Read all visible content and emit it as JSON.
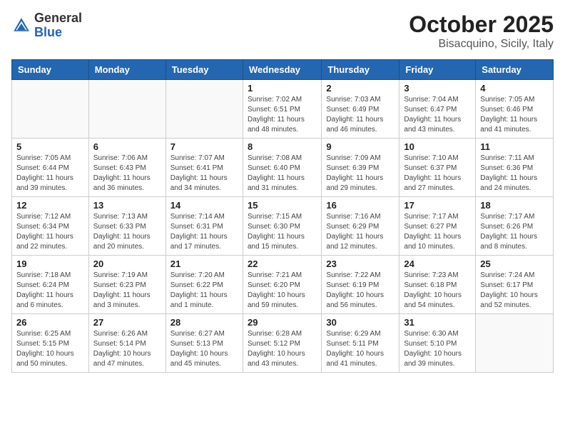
{
  "header": {
    "logo_general": "General",
    "logo_blue": "Blue",
    "month_title": "October 2025",
    "location": "Bisacquino, Sicily, Italy"
  },
  "days_of_week": [
    "Sunday",
    "Monday",
    "Tuesday",
    "Wednesday",
    "Thursday",
    "Friday",
    "Saturday"
  ],
  "weeks": [
    [
      {
        "day": "",
        "info": ""
      },
      {
        "day": "",
        "info": ""
      },
      {
        "day": "",
        "info": ""
      },
      {
        "day": "1",
        "info": "Sunrise: 7:02 AM\nSunset: 6:51 PM\nDaylight: 11 hours and 48 minutes."
      },
      {
        "day": "2",
        "info": "Sunrise: 7:03 AM\nSunset: 6:49 PM\nDaylight: 11 hours and 46 minutes."
      },
      {
        "day": "3",
        "info": "Sunrise: 7:04 AM\nSunset: 6:47 PM\nDaylight: 11 hours and 43 minutes."
      },
      {
        "day": "4",
        "info": "Sunrise: 7:05 AM\nSunset: 6:46 PM\nDaylight: 11 hours and 41 minutes."
      }
    ],
    [
      {
        "day": "5",
        "info": "Sunrise: 7:05 AM\nSunset: 6:44 PM\nDaylight: 11 hours and 39 minutes."
      },
      {
        "day": "6",
        "info": "Sunrise: 7:06 AM\nSunset: 6:43 PM\nDaylight: 11 hours and 36 minutes."
      },
      {
        "day": "7",
        "info": "Sunrise: 7:07 AM\nSunset: 6:41 PM\nDaylight: 11 hours and 34 minutes."
      },
      {
        "day": "8",
        "info": "Sunrise: 7:08 AM\nSunset: 6:40 PM\nDaylight: 11 hours and 31 minutes."
      },
      {
        "day": "9",
        "info": "Sunrise: 7:09 AM\nSunset: 6:39 PM\nDaylight: 11 hours and 29 minutes."
      },
      {
        "day": "10",
        "info": "Sunrise: 7:10 AM\nSunset: 6:37 PM\nDaylight: 11 hours and 27 minutes."
      },
      {
        "day": "11",
        "info": "Sunrise: 7:11 AM\nSunset: 6:36 PM\nDaylight: 11 hours and 24 minutes."
      }
    ],
    [
      {
        "day": "12",
        "info": "Sunrise: 7:12 AM\nSunset: 6:34 PM\nDaylight: 11 hours and 22 minutes."
      },
      {
        "day": "13",
        "info": "Sunrise: 7:13 AM\nSunset: 6:33 PM\nDaylight: 11 hours and 20 minutes."
      },
      {
        "day": "14",
        "info": "Sunrise: 7:14 AM\nSunset: 6:31 PM\nDaylight: 11 hours and 17 minutes."
      },
      {
        "day": "15",
        "info": "Sunrise: 7:15 AM\nSunset: 6:30 PM\nDaylight: 11 hours and 15 minutes."
      },
      {
        "day": "16",
        "info": "Sunrise: 7:16 AM\nSunset: 6:29 PM\nDaylight: 11 hours and 12 minutes."
      },
      {
        "day": "17",
        "info": "Sunrise: 7:17 AM\nSunset: 6:27 PM\nDaylight: 11 hours and 10 minutes."
      },
      {
        "day": "18",
        "info": "Sunrise: 7:17 AM\nSunset: 6:26 PM\nDaylight: 11 hours and 8 minutes."
      }
    ],
    [
      {
        "day": "19",
        "info": "Sunrise: 7:18 AM\nSunset: 6:24 PM\nDaylight: 11 hours and 6 minutes."
      },
      {
        "day": "20",
        "info": "Sunrise: 7:19 AM\nSunset: 6:23 PM\nDaylight: 11 hours and 3 minutes."
      },
      {
        "day": "21",
        "info": "Sunrise: 7:20 AM\nSunset: 6:22 PM\nDaylight: 11 hours and 1 minute."
      },
      {
        "day": "22",
        "info": "Sunrise: 7:21 AM\nSunset: 6:20 PM\nDaylight: 10 hours and 59 minutes."
      },
      {
        "day": "23",
        "info": "Sunrise: 7:22 AM\nSunset: 6:19 PM\nDaylight: 10 hours and 56 minutes."
      },
      {
        "day": "24",
        "info": "Sunrise: 7:23 AM\nSunset: 6:18 PM\nDaylight: 10 hours and 54 minutes."
      },
      {
        "day": "25",
        "info": "Sunrise: 7:24 AM\nSunset: 6:17 PM\nDaylight: 10 hours and 52 minutes."
      }
    ],
    [
      {
        "day": "26",
        "info": "Sunrise: 6:25 AM\nSunset: 5:15 PM\nDaylight: 10 hours and 50 minutes."
      },
      {
        "day": "27",
        "info": "Sunrise: 6:26 AM\nSunset: 5:14 PM\nDaylight: 10 hours and 47 minutes."
      },
      {
        "day": "28",
        "info": "Sunrise: 6:27 AM\nSunset: 5:13 PM\nDaylight: 10 hours and 45 minutes."
      },
      {
        "day": "29",
        "info": "Sunrise: 6:28 AM\nSunset: 5:12 PM\nDaylight: 10 hours and 43 minutes."
      },
      {
        "day": "30",
        "info": "Sunrise: 6:29 AM\nSunset: 5:11 PM\nDaylight: 10 hours and 41 minutes."
      },
      {
        "day": "31",
        "info": "Sunrise: 6:30 AM\nSunset: 5:10 PM\nDaylight: 10 hours and 39 minutes."
      },
      {
        "day": "",
        "info": ""
      }
    ]
  ]
}
